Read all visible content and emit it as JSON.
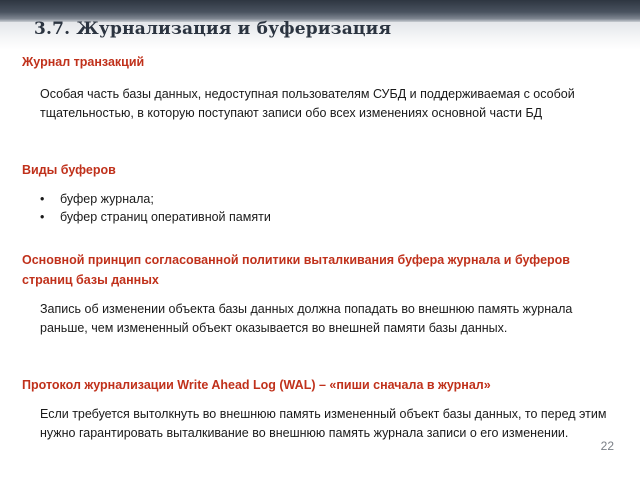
{
  "title": "3.7. Журнализация и буферизация",
  "sections": {
    "journal": {
      "heading": "Журнал транзакций",
      "text": "Особая часть базы данных, недоступная пользователям СУБД и поддерживаемая с особой тщательностью, в которую поступают записи обо всех изменениях основной части БД"
    },
    "buffers": {
      "heading": "Виды буферов",
      "items": [
        "буфер журнала;",
        "буфер страниц оперативной памяти"
      ]
    },
    "principle": {
      "heading": "Основной принцип согласованной политики выталкивания буфера журнала и буферов страниц базы данных",
      "text": "Запись об изменении объекта базы данных должна попадать во внешнюю память журнала раньше, чем измененный объект оказывается во внешней памяти базы данных."
    },
    "wal": {
      "heading": "Протокол журнализации Write Ahead Log (WAL) – «пиши сначала в журнал»",
      "text": "Если требуется вытолкнуть во внешнюю память измененный объект базы данных, то перед этим нужно гарантировать выталкивание во внешнюю память журнала записи о его изменении."
    }
  },
  "slide_number": "22",
  "colors": {
    "heading": "#c0311b",
    "title": "#2b3440",
    "band": "#3a424d"
  }
}
